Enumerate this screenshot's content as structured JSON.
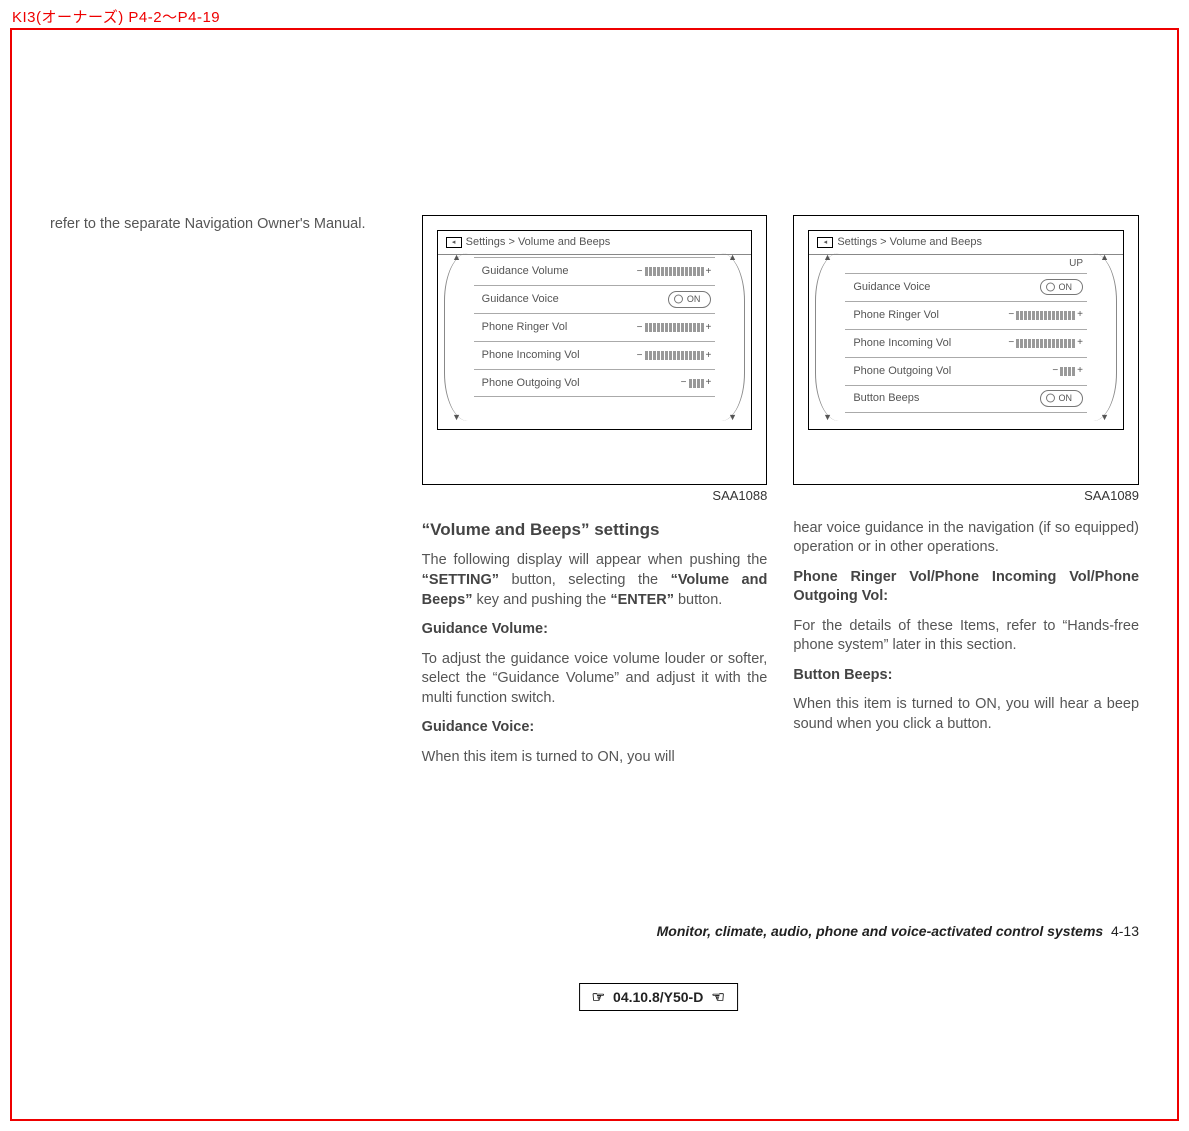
{
  "top_header": "KI3(オーナーズ) P4-2～P4-19",
  "left_col": {
    "intro": "refer to the separate Navigation Owner's Manual."
  },
  "fig1": {
    "caption": "SAA1088",
    "breadcrumb": "Settings > Volume and Beeps",
    "rows": [
      {
        "label": "Guidance Volume",
        "ctrl": "slider"
      },
      {
        "label": "Guidance Voice",
        "ctrl": "toggle",
        "toggle_text": "ON"
      },
      {
        "label": "Phone Ringer Vol",
        "ctrl": "slider"
      },
      {
        "label": "Phone Incoming Vol",
        "ctrl": "slider"
      },
      {
        "label": "Phone Outgoing Vol",
        "ctrl": "slider_mini"
      }
    ]
  },
  "fig2": {
    "caption": "SAA1089",
    "breadcrumb": "Settings > Volume and Beeps",
    "up_label": "UP",
    "rows": [
      {
        "label": "Guidance Voice",
        "ctrl": "toggle",
        "toggle_text": "ON"
      },
      {
        "label": "Phone Ringer Vol",
        "ctrl": "slider"
      },
      {
        "label": "Phone Incoming Vol",
        "ctrl": "slider"
      },
      {
        "label": "Phone Outgoing Vol",
        "ctrl": "slider_mini"
      },
      {
        "label": "Button Beeps",
        "ctrl": "toggle",
        "toggle_text": "ON"
      }
    ]
  },
  "center_col": {
    "heading": "“Volume and Beeps” settings",
    "p1a": "The following display will appear when pushing the ",
    "p1b_bold": "“SETTING”",
    "p1c": " button, selecting the ",
    "p1d_bold": "“Volume and Beeps”",
    "p1e": " key and pushing the ",
    "p1f_bold": "“ENTER”",
    "p1g": " button.",
    "h_gvol": "Guidance Volume:",
    "p_gvol": "To adjust the guidance voice volume louder or softer, select the “Guidance Volume” and adjust it with the multi function switch.",
    "h_gvoice": "Guidance Voice:",
    "p_gvoice": "When this item is turned to ON, you will"
  },
  "right_col": {
    "p_gvoice2": "hear voice guidance in the navigation (if so equipped) operation or in other operations.",
    "h_phone": "Phone Ringer Vol/Phone Incoming Vol/Phone Outgoing Vol:",
    "p_phone": "For the details of these Items, refer to “Hands-free phone system” later in this section.",
    "h_beeps": "Button Beeps:",
    "p_beeps": "When this item is turned to ON, you will hear a beep sound when you click a button."
  },
  "footer": {
    "section": "Monitor, climate, audio, phone and voice-activated control systems",
    "page": "4-13"
  },
  "stamp": {
    "left_hand": "☞",
    "text": "04.10.8/Y50-D",
    "right_hand": "☜"
  },
  "glyphs": {
    "minus": "−",
    "plus": "+",
    "up": "▲",
    "down": "▼"
  }
}
